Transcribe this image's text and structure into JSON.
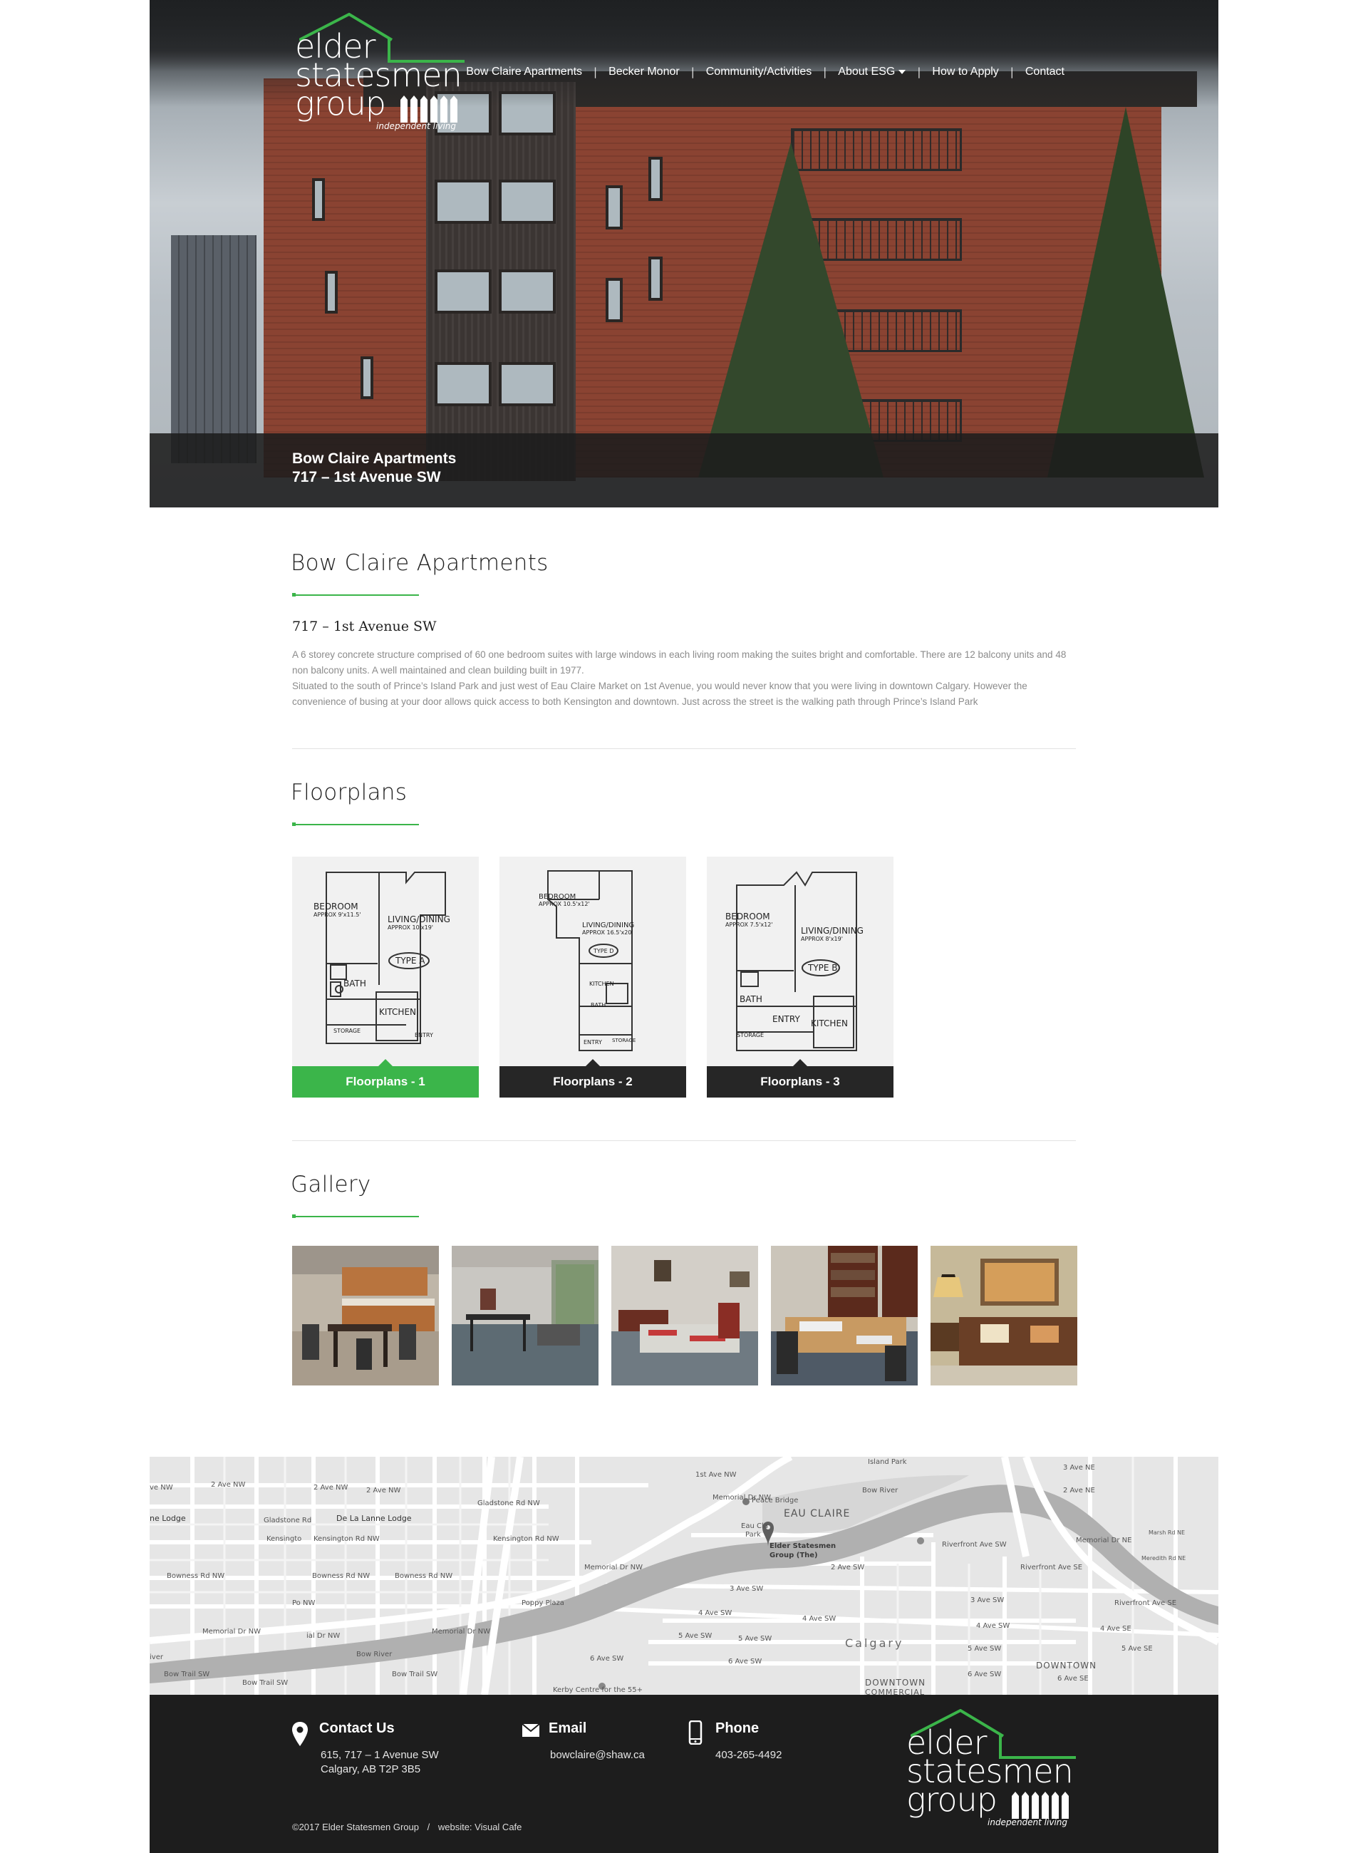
{
  "brand": {
    "logo_line1": "elder",
    "logo_line2": "statesmen",
    "logo_line3": "group",
    "logo_tagline": "independent living",
    "accent_color": "#3bb54a",
    "dark_color": "#1d1d1d"
  },
  "nav": {
    "items": [
      {
        "label": "Bow Claire Apartments"
      },
      {
        "label": "Becker Monor"
      },
      {
        "label": "Community/Activities"
      },
      {
        "label": "About ESG",
        "has_dropdown": true
      },
      {
        "label": "How to Apply"
      },
      {
        "label": "Contact"
      }
    ],
    "separator": "|"
  },
  "hero": {
    "caption_line1": "Bow Claire Apartments",
    "caption_line2": "717 – 1st Avenue SW"
  },
  "about": {
    "title": "Bow Claire Apartments",
    "address": "717 – 1st Avenue SW",
    "paragraph1": "A 6 storey concrete structure comprised of 60 one bedroom suites with large windows in each living room making the suites bright and comfortable. There are 12 balcony units and 48 non balcony units. A well maintained and clean building built in 1977.",
    "paragraph2": "Situated to the south of Prince’s Island Park and just west of Eau Claire Market on 1st Avenue, you would never know that you were living in downtown Calgary. However the convenience of busing at your door allows quick access to both Kensington and downtown. Just across the street is the walking path through Prince’s Island Park"
  },
  "floorplans": {
    "title": "Floorplans",
    "cards": [
      {
        "button": "Floorplans - 1",
        "active": true,
        "labels": {
          "bedroom": "BEDROOM",
          "bedroom_size": "APPROX 9'x11.5'",
          "living": "LIVING/DINING",
          "living_size": "APPROX 10'x19'",
          "type": "TYPE A",
          "bath": "BATH",
          "kitchen": "KITCHEN",
          "storage": "STORAGE",
          "entry": "ENTRY"
        }
      },
      {
        "button": "Floorplans - 2",
        "active": false,
        "labels": {
          "bedroom": "BEDROOM",
          "bedroom_size": "APPROX 10.5'x12'",
          "living": "LIVING/DINING",
          "living_size": "APPROX 16.5'x20'",
          "type": "TYPE D",
          "bath": "BATH",
          "kitchen": "KITCHEN",
          "storage": "STORAGE",
          "entry": "ENTRY"
        }
      },
      {
        "button": "Floorplans - 3",
        "active": false,
        "labels": {
          "bedroom": "BEDROOM",
          "bedroom_size": "APPROX 7.5'x12'",
          "living": "LIVING/DINING",
          "living_size": "APPROX 8'x19'",
          "type": "TYPE B",
          "bath": "BATH",
          "kitchen": "KITCHEN",
          "storage": "STORAGE",
          "entry": "ENTRY"
        }
      }
    ]
  },
  "gallery": {
    "title": "Gallery",
    "images": [
      {
        "name": "kitchen-dining-room-photo"
      },
      {
        "name": "lounge-tables-photo"
      },
      {
        "name": "game-room-photo"
      },
      {
        "name": "library-table-photo"
      },
      {
        "name": "sitting-room-photo"
      }
    ]
  },
  "map": {
    "labels": {
      "island_park": "Island Park",
      "peace_bridge": "Peace Bridge",
      "eau_claire": "EAU CLAIRE",
      "eau_claire_park_1": "Eau Cla",
      "eau_claire_park_2": "Park",
      "marker_line1": "Elder Statesmen",
      "marker_line2": "Group (The)",
      "de_la_lanne": "De La Lanne Lodge",
      "lodge": "ne Lodge",
      "poppy_plaza": "Poppy Plaza",
      "bow_river_1": "Bow River",
      "bow_river_2": "Bow River",
      "calgary": "Calgary",
      "downtown_1": "DOWNTOWN",
      "downtown_2": "DOWNTOWN",
      "commercial": "COMMERCIAL",
      "kerby": "Kerby Centre for the 55+",
      "memorial_dr_nw_1": "Memorial Dr NW",
      "memorial_dr_nw_2": "Memorial Dr NW",
      "memorial_dr_nw_3": "Memorial Dr NW",
      "memorial_dr_ne": "Memorial Dr NE",
      "memorial_dr_nw_4": "Memorial Dr NW",
      "riverfront_ave_sw": "Riverfront Ave SW",
      "riverfront_ave_se_1": "Riverfront Ave SE",
      "riverfront_ave_se_2": "Riverfront Ave SE",
      "kensington_rd": "Kensington Rd NW",
      "kensington_rd_2": "Kensington Rd NW",
      "kensington_rd_3": "Kensingto",
      "bowness_rd_1": "Bowness Rd NW",
      "bowness_rd_2": "Bowness Rd NW",
      "bowness_rd_3": "Bowness Rd NW",
      "bow_trail_1": "Bow Trail SW",
      "bow_trail_2": "Bow Trail SW",
      "bow_trail_3": "Bow Trail SW",
      "two_ave_nw_1": "2 Ave NW",
      "two_ave_nw_2": "2 Ave NW",
      "two_ave_nw_3": "2 Ave NW",
      "two_ave_sw": "2 Ave SW",
      "three_ave_sw": "3 Ave SW",
      "three_ave_sw_2": "3 Ave SW",
      "four_ave_sw_1": "4 Ave SW",
      "four_ave_sw_2": "4 Ave SW",
      "four_ave_sw_3": "4 Ave SW",
      "four_ave_se": "4 Ave SE",
      "five_ave_sw_1": "5 Ave SW",
      "five_ave_sw_2": "5 Ave SW",
      "five_ave_sw_3": "5 Ave SW",
      "five_ave_se": "5 Ave SE",
      "six_ave_sw_1": "6 Ave SW",
      "six_ave_sw_2": "6 Ave SW",
      "six_ave_sw_3": "6 Ave SW",
      "six_ave_se": "6 Ave SE",
      "three_ave_ne": "3 Ave NE",
      "two_ave_ne": "2 Ave NE",
      "marsh_rd": "Marsh Rd NE",
      "meredith_rd": "Meredith Rd NE",
      "first_ave_nw": "1st Ave NW",
      "gladstone_rd": "Gladstone Rd",
      "gladstone_rd_2": "Gladstone Rd NW",
      "po_nw": "Po NW",
      "lal_dr_nw": "ial Dr NW",
      "iver": "iver",
      "ave_nw": "ve NW"
    }
  },
  "footer": {
    "contact_title": "Contact Us",
    "contact_line1": "615, 717 – 1 Avenue SW",
    "contact_line2": "Calgary, AB T2P 3B5",
    "email_title": "Email",
    "email": "bowclaire@shaw.ca",
    "phone_title": "Phone",
    "phone": "403-265-4492",
    "copyright": "©2017 Elder Statesmen Group",
    "copy_sep": "/",
    "website_credit": "website: Visual Cafe"
  }
}
